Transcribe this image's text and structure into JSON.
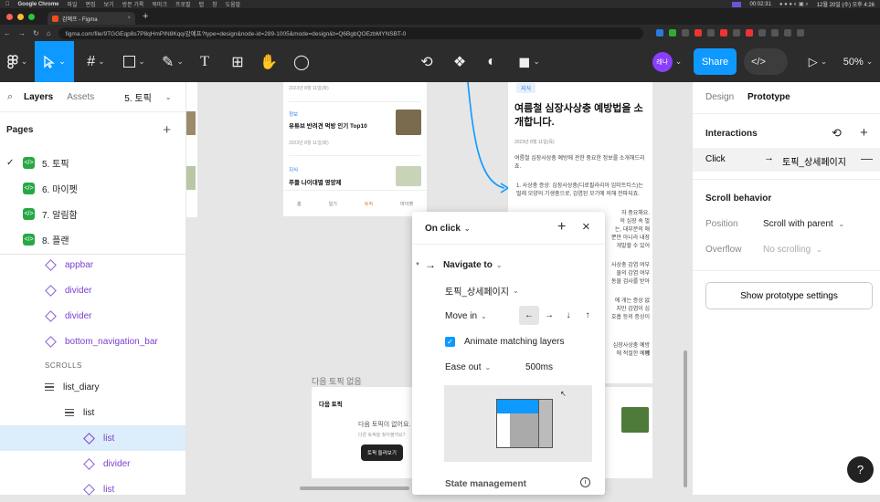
{
  "mac_menu": {
    "app": "Google Chrome",
    "items": [
      "파일",
      "편집",
      "보기",
      "방문 기록",
      "북마크",
      "프로필",
      "탭",
      "창",
      "도움말"
    ],
    "timer": "00:02:31",
    "date": "12월 20일 (수) 오후 4:26"
  },
  "browser": {
    "tab_title": "감예프 - Figma",
    "new_tab": "+",
    "url": "figma.com/file/9TGGEqp8s7P8qHmPIN8Kqq/감예프?type=design&node-id=289-1005&mode=design&t=Q6BgbQOEzbMYNSBT-0"
  },
  "toolbar": {
    "avatar": "레나",
    "share": "Share",
    "zoom": "50%",
    "accent": "#0d99ff"
  },
  "layers": {
    "tab_layers": "Layers",
    "tab_assets": "Assets",
    "page_selector": "5. 토픽",
    "pages_title": "Pages",
    "add": "+",
    "pages": [
      "5. 토픽",
      "6. 마이펫",
      "7. 알림함",
      "8. 플랜"
    ],
    "components": [
      "appbar",
      "divider",
      "divider",
      "bottom_navigation_bar"
    ],
    "scrolls_label": "SCROLLS",
    "list_diary": "list_diary",
    "list": "list",
    "sub_list": "list",
    "sub_divider": "divider",
    "sub_list2": "list"
  },
  "canvas": {
    "card_left": {
      "date1": "2023년 8월 11일(화)",
      "tag1": "정보",
      "title1": "유튜브 반려견 먹방 인기 Top10",
      "date2": "2023년 8월 11일(화)",
      "tag2": "지식",
      "title2": "푸들 나이대별 영양제",
      "nav": [
        "홈",
        "일기",
        "토픽",
        "마이펫"
      ]
    },
    "card_right": {
      "tag": "지식",
      "title": "여름철 심장사상충 예방법을 소개합니다.",
      "date": "2023년 8월 11일(목)",
      "intro": "여름철 심장사상충 예방에 관한 중요한 정보를 소개해드리죠.",
      "item1": "1. 사상충 증상: 심장사상충(디로필라리아 임미트티스)는 벌레 모양의 기생충으로, 감염된 모기에 의해 전파되죠.",
      "frag1": "자 중요해요.",
      "frag2": "의 심장 속 벌",
      "frag3": "는, 대부분의 애",
      "frag4": "뿐만 아니라 내장",
      "frag5": "개발할 수 있어",
      "frag6": "사상충 감염 여부",
      "frag7": "물의 감염 여부",
      "frag8": "동물 검사를 받아",
      "frag9": "에 개는 증상 없",
      "frag10": "지만 감염이 심",
      "frag11": "호흡 등의 증상이",
      "frag12": "심장사상충 예방에",
      "frag13": "에 적절한 예방"
    },
    "next_label": "다음 토픽 없음",
    "next_card": {
      "title": "다음 토픽",
      "empty": "다음 토픽이 없어요.",
      "sub": "다른 토픽을 찾아볼까요?",
      "btn": "토픽 둘러보기"
    }
  },
  "popup": {
    "trigger": "On click",
    "action": "Navigate to",
    "destination": "토픽_상세페이지",
    "animation": "Move in",
    "matching": "Animate matching layers",
    "easing": "Ease out",
    "duration": "500ms",
    "state": "State management"
  },
  "right_panel": {
    "tab_design": "Design",
    "tab_prototype": "Prototype",
    "interactions": "Interactions",
    "click": "Click",
    "dest": "토픽_상세페이지",
    "scroll_behavior": "Scroll behavior",
    "position_label": "Position",
    "position_value": "Scroll with parent",
    "overflow_label": "Overflow",
    "overflow_value": "No scrolling",
    "settings_btn": "Show prototype settings",
    "help": "?"
  }
}
